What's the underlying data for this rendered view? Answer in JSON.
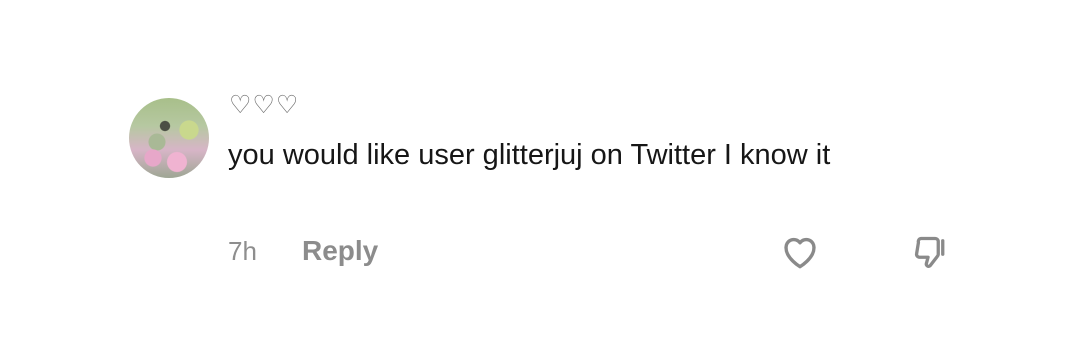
{
  "comment": {
    "username": "♡♡♡",
    "text": "you would like user glitterjuj on Twitter I know it",
    "timestamp": "7h",
    "reply_label": "Reply",
    "icons": {
      "like": "heart-icon",
      "dislike": "thumbs-down-icon"
    }
  }
}
